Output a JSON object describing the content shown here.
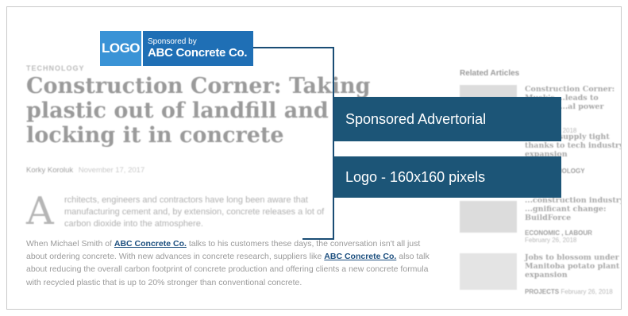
{
  "sponsor": {
    "logo_text": "LOGO",
    "sponsored_by": "Sponsored by",
    "sponsor_name": "ABC Concrete Co."
  },
  "article": {
    "kicker": "TECHNOLOGY",
    "headline": "Construction Corner: Taking plastic out of landfill and locking it in concrete",
    "author": "Korky Koroluk",
    "date": "November 17, 2017",
    "dropcap": "A",
    "intro": "rchitects, engineers and contractors have long been aware that manufacturing cement and, by extension, concrete releases a lot of carbon dioxide into the atmosphere.",
    "body_1": "When Michael Smith of",
    "body_link_1": "ABC Concrete Co.",
    "body_2": " talks to his customers these days, the conversation isn't all just about ordering concrete. With new advances in concrete research, suppliers like",
    "body_link_2": "ABC Concrete Co.",
    "body_3": " also talk about reducing the overall carbon footprint of concrete production and offering clients a new concrete formula with recycled plastic that is up to 20% stronger than conventional concrete."
  },
  "related": {
    "title": "Related Articles",
    "items": [
      {
        "headline": "Construction Corner: Musk's ...leads to 'world's ...al power plant'",
        "category": "",
        "date": "February 26, 2018"
      },
      {
        "headline": "...office supply tight thanks to tech industry expansion",
        "category": "...C , TECHNOLOGY",
        "date": ""
      },
      {
        "headline": "...construction industry ...gnificant change: BuildForce",
        "category": "ECONOMIC , LABOUR",
        "date": "February 26, 2018"
      },
      {
        "headline": "Jobs to blossom under Manitoba potato plant expansion",
        "category": "PROJECTS",
        "date": "February 26, 2018"
      }
    ]
  },
  "callouts": {
    "advertorial": "Sponsored Advertorial",
    "logo_size": "Logo - 160x160 pixels"
  },
  "colors": {
    "callout_bg": "#1c5577",
    "logo_bg": "#3a93d6",
    "sponsor_bg": "#1f6fb5",
    "link": "#1c4f7f"
  }
}
